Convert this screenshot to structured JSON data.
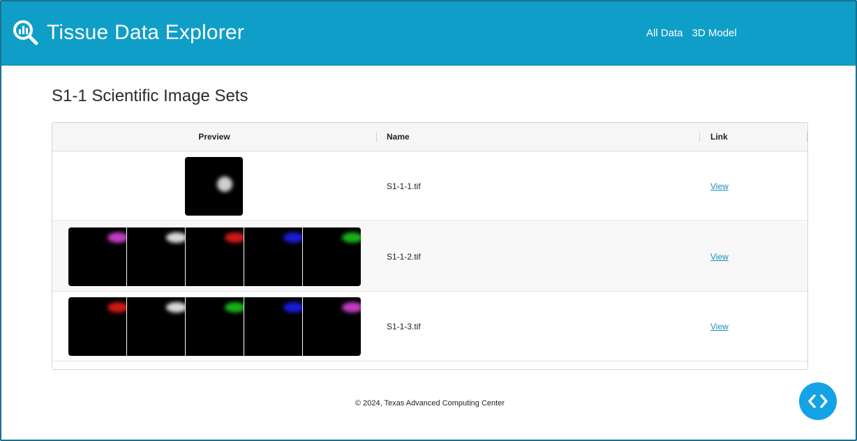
{
  "header": {
    "brand_icon": "magnifier-chart-icon",
    "title": "Tissue Data Explorer",
    "nav": [
      {
        "label": "All Data"
      },
      {
        "label": "3D Model"
      }
    ]
  },
  "main": {
    "page_title": "S1-1 Scientific Image Sets",
    "table": {
      "columns": [
        "Preview",
        "Name",
        "Link"
      ],
      "rows": [
        {
          "name": "S1-1-1.tif",
          "link": "View",
          "preview_channels": [
            "#cfcfcf"
          ]
        },
        {
          "name": "S1-1-2.tif",
          "link": "View",
          "preview_channels": [
            "#c23cc2",
            "#d9d9d9",
            "#d01818",
            "#1a1ad8",
            "#18b018"
          ]
        },
        {
          "name": "S1-1-3.tif",
          "link": "View",
          "preview_channels": [
            "#d01818",
            "#d9d9d9",
            "#18b018",
            "#1a1ad8",
            "#c23cc2"
          ]
        }
      ]
    }
  },
  "footer": {
    "text": "© 2024, Texas Advanced Computing Center"
  },
  "fab": {
    "icon": "code-brackets-icon"
  },
  "colors": {
    "header_bg": "#0f9ec8",
    "link": "#1a8ec0",
    "fab_bg": "#14a3e6"
  }
}
